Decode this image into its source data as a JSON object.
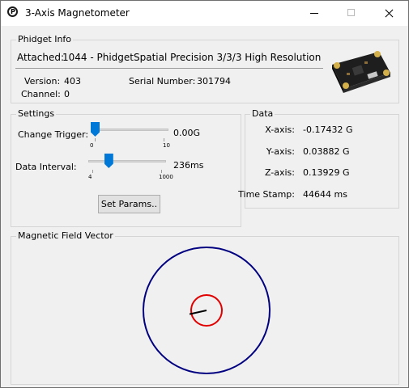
{
  "window": {
    "title": "3-Axis Magnetometer"
  },
  "phidget_info": {
    "group_title": "Phidget Info",
    "attached_label": "Attached:",
    "attached_value": "1044 - PhidgetSpatial Precision 3/3/3 High Resolution",
    "version_label": "Version:",
    "version_value": "403",
    "serial_label": "Serial Number:",
    "serial_value": "301794",
    "channel_label": "Channel:",
    "channel_value": "0"
  },
  "settings": {
    "group_title": "Settings",
    "change_trigger_label": "Change Trigger:",
    "change_trigger_value": "0.00G",
    "change_trigger_min": "0",
    "change_trigger_max": "10",
    "change_trigger_level": 0.0,
    "data_interval_label": "Data Interval:",
    "data_interval_value": "236ms",
    "data_interval_min": "4",
    "data_interval_max": "1000",
    "data_interval_level": 0.233,
    "set_params_label": "Set Params.."
  },
  "data": {
    "group_title": "Data",
    "x_label": "X-axis:",
    "x_value": "-0.17432 G",
    "y_label": "Y-axis:",
    "y_value": "0.03882 G",
    "z_label": "Z-axis:",
    "z_value": "0.13929 G",
    "timestamp_label": "Time Stamp:",
    "timestamp_value": "44644 ms"
  },
  "vector": {
    "group_title": "Magnetic Field Vector",
    "outer_circle_color": "#000080",
    "inner_circle_color": "#e00000",
    "vector_color": "#000000"
  }
}
